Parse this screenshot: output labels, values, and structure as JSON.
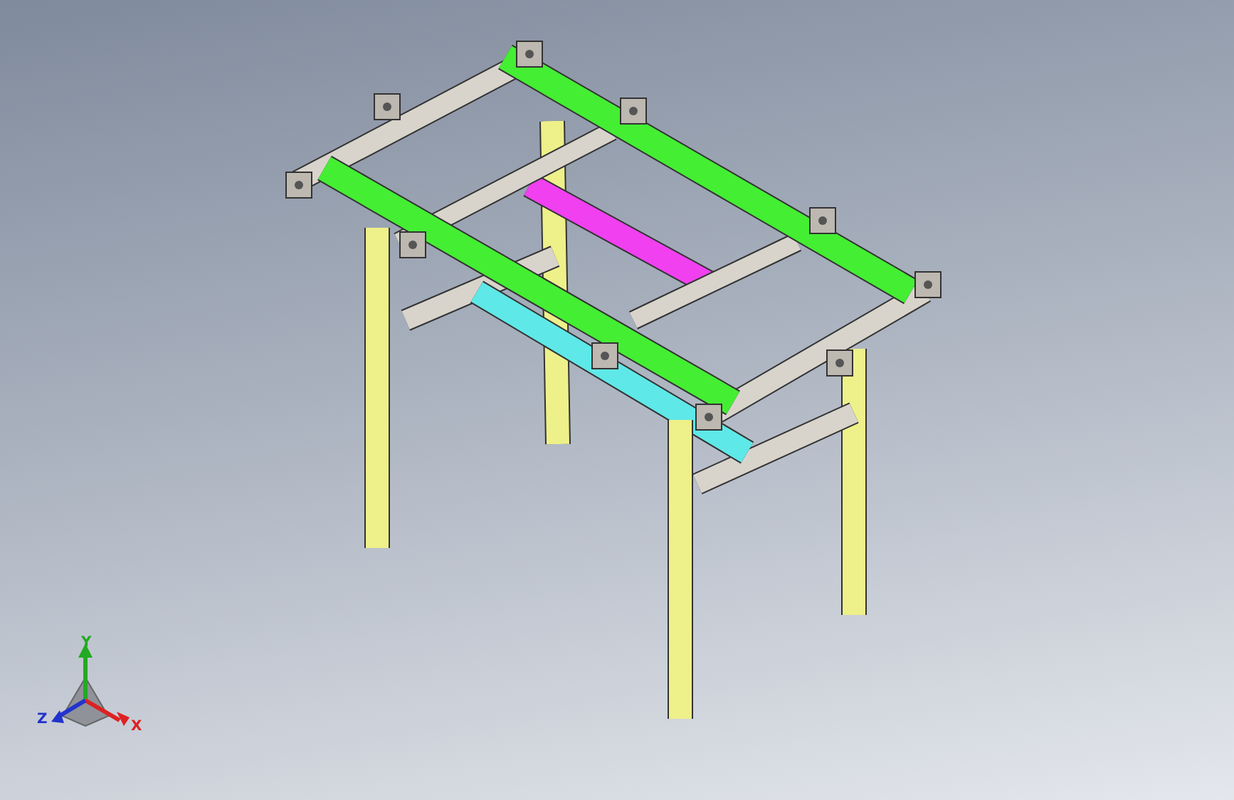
{
  "viewport": {
    "triad": {
      "y_label": "Y",
      "x_label": "X",
      "z_label": "Z"
    }
  }
}
